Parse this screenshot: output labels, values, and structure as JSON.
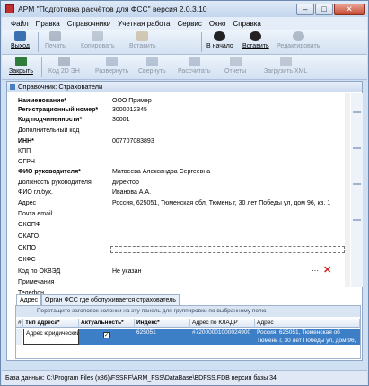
{
  "window": {
    "title": "АРМ \"Подготовка расчётов для ФСС\"  версия 2.0.3.10"
  },
  "menu": [
    "Файл",
    "Правка",
    "Справочники",
    "Учетная работа",
    "Сервис",
    "Окно",
    "Справка"
  ],
  "toolbar1": {
    "exit": "Выход",
    "print": "Печать",
    "copy": "Копировать",
    "paste": "Вставить",
    "to_start": "В начало",
    "paste2": "Вставить",
    "edit": "Редактировать"
  },
  "toolbar2": {
    "close": "Закрыть",
    "code": "Код 2D ЭН",
    "expand": "Развернуть",
    "collapse": "Свернуть",
    "calc": "Рассчитать",
    "reports": "Отчеты",
    "load_xml": "Загрузить XML"
  },
  "dialog": {
    "title": "Справочник: Страхователи"
  },
  "form": {
    "fields": [
      {
        "label": "Наименование*",
        "value": "ООО Пример",
        "bold": true
      },
      {
        "label": "Регистрационный номер*",
        "value": "3000012345",
        "bold": true
      },
      {
        "label": "Код подчиненности*",
        "value": "30001",
        "bold": true
      },
      {
        "label": "Дополнительный код",
        "value": "",
        "bold": false
      },
      {
        "label": "ИНН*",
        "value": "007707083893",
        "bold": true
      },
      {
        "label": "КПП",
        "value": "",
        "bold": false
      },
      {
        "label": "ОГРН",
        "value": "",
        "bold": false
      },
      {
        "label": "ФИО руководителя*",
        "value": "Матвеева Александра Сергеевна",
        "bold": true
      },
      {
        "label": "Должность руководителя",
        "value": "директор",
        "bold": false
      },
      {
        "label": "ФИО гл.бух.",
        "value": "Иванова А.А.",
        "bold": false
      },
      {
        "label": "Адрес",
        "value": "Россия, 625051, Тюменская обл, Тюмень г, 30 лет Победы ул, дом 96, кв. 1",
        "bold": false
      },
      {
        "label": "Почта email",
        "value": "",
        "bold": false
      },
      {
        "label": "ОКОПФ",
        "value": "",
        "bold": false
      },
      {
        "label": "ОКАТО",
        "value": "",
        "bold": false
      },
      {
        "label": "ОКПО",
        "value": "",
        "bold": false
      },
      {
        "label": "ОКФС",
        "value": "",
        "bold": false
      },
      {
        "label": "Код по ОКВЭД",
        "value": "Не указан",
        "bold": false
      },
      {
        "label": "Примечания",
        "value": "",
        "bold": false
      },
      {
        "label": "Телефон",
        "value": "",
        "bold": false
      }
    ]
  },
  "tabs": [
    "Адрес",
    "Орган ФСС где обслуживается страхователь"
  ],
  "grid": {
    "group_hint": "Перетащите заголовок колонки на эту панель для группировки по выбранному полю",
    "columns": [
      "Тип адреса*",
      "Актуальность*",
      "Индекс*",
      "Адрес по КЛАДР",
      "Адрес"
    ],
    "rows": [
      {
        "type": "Адрес юридический",
        "actual": "✓",
        "index": "625051",
        "kladr": "#72000001000024900",
        "address": "Россия, 625051, Тюменская об Тюмень г, 30 лет Победы ул, дом 96, кв. 1"
      }
    ]
  },
  "status": "База данных: C:\\Program Files (x86)\\FSSRF\\ARM_FSS\\DataBase\\BDFSS.FDB   версия базы 34",
  "colors": {
    "accent": "#3d7fc7",
    "close": "#c44a33"
  }
}
